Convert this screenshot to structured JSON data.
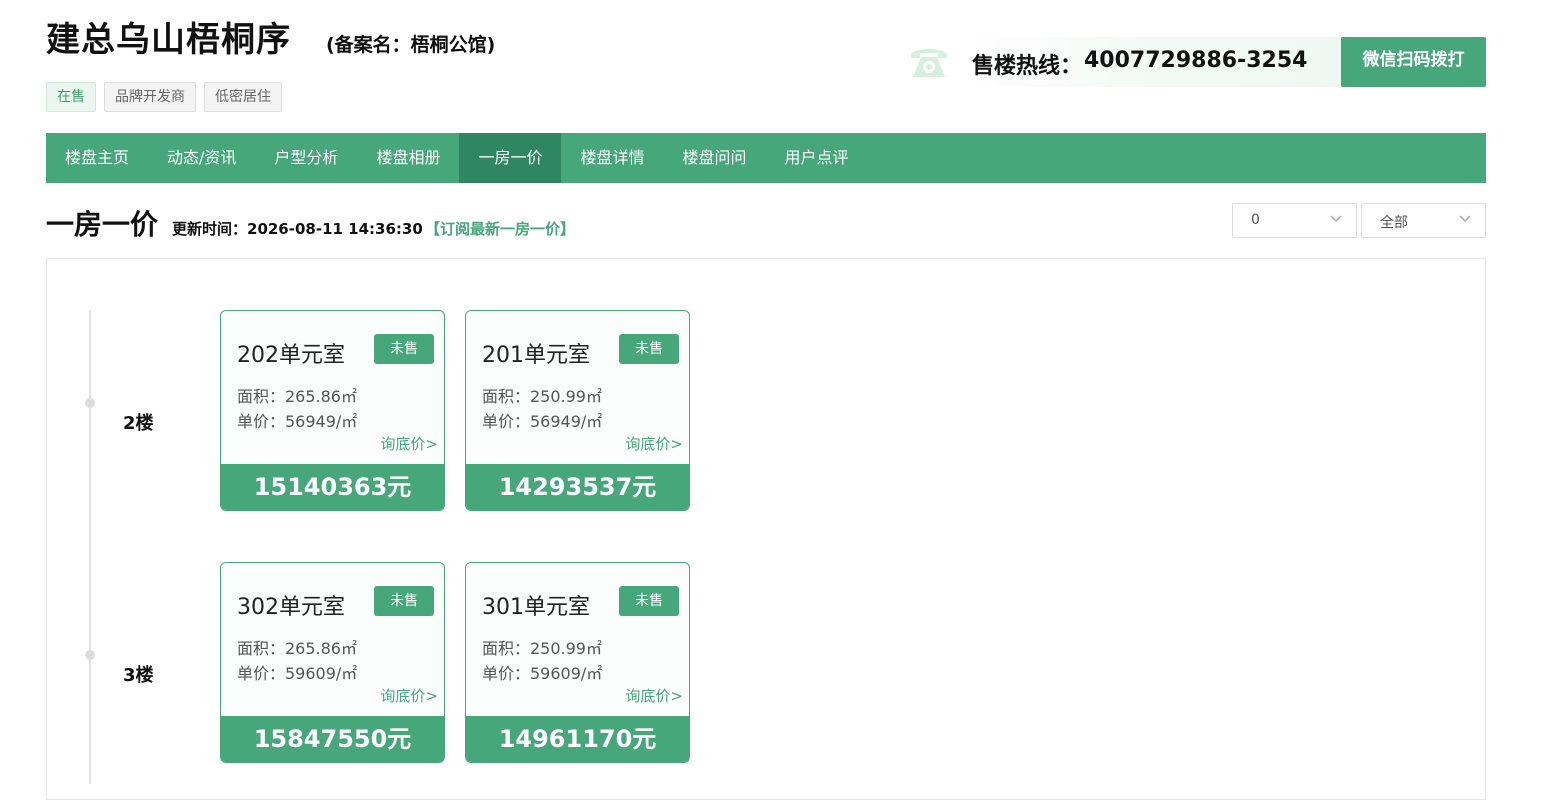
{
  "header": {
    "title": "建总乌山梧桐序",
    "alias": "(备案名：梧桐公馆)",
    "tags": [
      "在售",
      "品牌开发商",
      "低密居住"
    ]
  },
  "hotline": {
    "label": "售楼热线：",
    "number": "4007729886-3254",
    "wechat_button": "微信扫码拨打"
  },
  "nav": {
    "items": [
      "楼盘主页",
      "动态/资讯",
      "户型分析",
      "楼盘相册",
      "一房一价",
      "楼盘详情",
      "楼盘问问",
      "用户点评"
    ],
    "active_index": 4
  },
  "section": {
    "title": "一房一价",
    "update_label": "更新时间：2026-08-11 14:36:30",
    "subscribe": "【订阅最新一房一价】"
  },
  "filters": {
    "building": "0",
    "status": "全部"
  },
  "floors": [
    {
      "label": "2楼",
      "units": [
        {
          "name": "202单元室",
          "status": "未售",
          "area": "面积：265.86㎡",
          "price": "单价：56949/㎡",
          "ask": "询底价>",
          "total": "15140363元"
        },
        {
          "name": "201单元室",
          "status": "未售",
          "area": "面积：250.99㎡",
          "price": "单价：56949/㎡",
          "ask": "询底价>",
          "total": "14293537元"
        }
      ]
    },
    {
      "label": "3楼",
      "units": [
        {
          "name": "302单元室",
          "status": "未售",
          "area": "面积：265.86㎡",
          "price": "单价：59609/㎡",
          "ask": "询底价>",
          "total": "15847550元"
        },
        {
          "name": "301单元室",
          "status": "未售",
          "area": "面积：250.99㎡",
          "price": "单价：59609/㎡",
          "ask": "询底价>",
          "total": "14961170元"
        }
      ]
    }
  ],
  "colors": {
    "accent": "#46a77b",
    "accent_dark": "#2f8761"
  }
}
